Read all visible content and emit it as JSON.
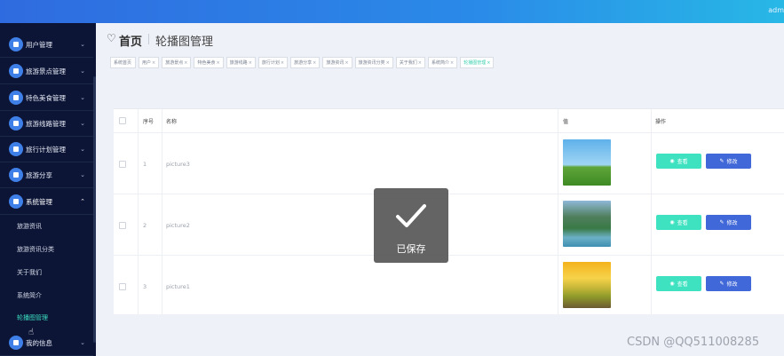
{
  "topbar": {
    "user": "adm"
  },
  "sidebar": {
    "menus": [
      {
        "label": "用户管理",
        "chevron": "⌄",
        "icon": "user-icon"
      },
      {
        "label": "旅游景点管理",
        "chevron": "⌄",
        "icon": "grid-icon"
      },
      {
        "label": "特色美食管理",
        "chevron": "⌄",
        "icon": "grid-icon"
      },
      {
        "label": "旅游线路管理",
        "chevron": "⌄",
        "icon": "list-icon"
      },
      {
        "label": "旅行计划管理",
        "chevron": "⌄",
        "icon": "grid-icon"
      },
      {
        "label": "旅游分享",
        "chevron": "⌄",
        "icon": "grid-icon"
      },
      {
        "label": "系统管理",
        "chevron": "⌃",
        "icon": "gear-icon"
      }
    ],
    "sub_items": [
      {
        "label": "旅游资讯"
      },
      {
        "label": "旅游资讯分类"
      },
      {
        "label": "关于我们"
      },
      {
        "label": "系统简介"
      },
      {
        "label": "轮播图管理"
      }
    ],
    "bottom_menu": {
      "label": "我的信息",
      "chevron": "⌄",
      "icon": "card-icon"
    }
  },
  "header": {
    "home_icon": "♡",
    "home": "首页",
    "title": "轮播图管理"
  },
  "tags": [
    {
      "label": "系统首页",
      "close": ""
    },
    {
      "label": "用户",
      "close": "×"
    },
    {
      "label": "旅游景点",
      "close": "×"
    },
    {
      "label": "特色美食",
      "close": "×"
    },
    {
      "label": "旅游线路",
      "close": "×"
    },
    {
      "label": "旅行计划",
      "close": "×"
    },
    {
      "label": "旅游分享",
      "close": "×"
    },
    {
      "label": "旅游资讯",
      "close": "×"
    },
    {
      "label": "旅游资讯分类",
      "close": "×"
    },
    {
      "label": "关于我们",
      "close": "×"
    },
    {
      "label": "系统简介",
      "close": "×"
    },
    {
      "label": "轮播图管理",
      "close": "×"
    }
  ],
  "table": {
    "headers": {
      "index": "序号",
      "name": "名称",
      "value": "值",
      "actions": "操作"
    },
    "rows": [
      {
        "index": "1",
        "name": "picture3",
        "view": "查看",
        "edit": "修改"
      },
      {
        "index": "2",
        "name": "picture2",
        "view": "查看",
        "edit": "修改"
      },
      {
        "index": "3",
        "name": "picture1",
        "view": "查看",
        "edit": "修改"
      }
    ]
  },
  "toast": {
    "message": "已保存"
  },
  "watermark": "CSDN @QQ511008285"
}
